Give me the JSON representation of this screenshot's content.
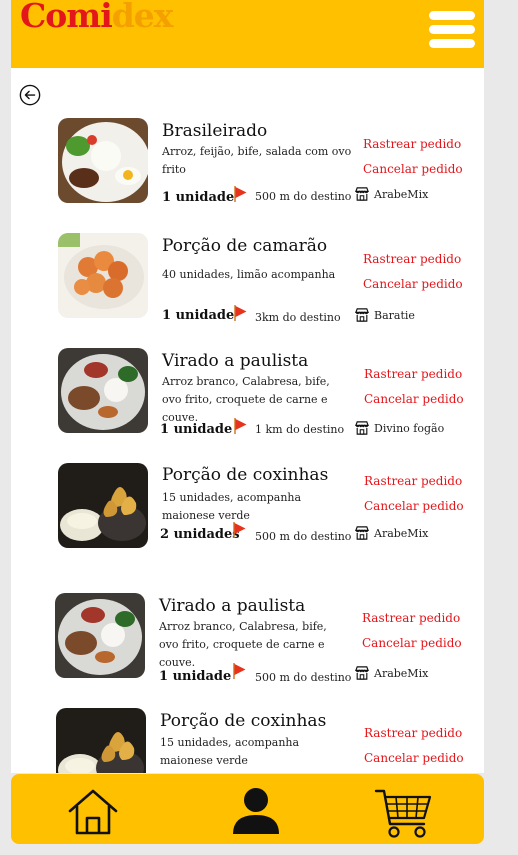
{
  "app": {
    "logo_part1": "Comi",
    "logo_part2": "dex"
  },
  "actions": {
    "track": "Rastrear pedido",
    "cancel": "Cancelar pedido"
  },
  "orders": [
    {
      "name": "Brasileirado",
      "desc": "Arroz, feijão, bife, salada com ovo frito",
      "qty": "1 unidade",
      "dist": "500 m do destino",
      "store": "ArabeMix"
    },
    {
      "name": "Porção de camarão",
      "desc": "40 unidades, limão acompanha",
      "qty": "1 unidade",
      "dist": "3km do destino",
      "store": "Baratie"
    },
    {
      "name": "Virado a paulista",
      "desc": "Arroz branco, Calabresa, bife, ovo frito, croquete de carne e couve.",
      "qty": "1 unidade",
      "dist": "1 km do destino",
      "store": "Divino fogão"
    },
    {
      "name": "Porção de coxinhas",
      "desc": "15 unidades, acompanha maionese verde",
      "qty": "2 unidades",
      "dist": "500 m do destino",
      "store": "ArabeMix"
    },
    {
      "name": "Virado a paulista",
      "desc": "Arroz branco, Calabresa, bife, ovo frito, croquete de carne e couve.",
      "qty": "1 unidade",
      "dist": "500 m do destino",
      "store": "ArabeMix"
    },
    {
      "name": "Porção de coxinhas",
      "desc": "15 unidades, acompanha maionese verde",
      "qty": "",
      "dist": "",
      "store": ""
    }
  ],
  "icons": {
    "menu": "hamburger-icon",
    "back": "arrow-left-circle-icon",
    "flag": "flag-icon",
    "store": "store-icon",
    "home": "home-icon",
    "profile": "user-icon",
    "cart": "cart-icon"
  },
  "colors": {
    "brand_yellow": "#ffc000",
    "logo_red": "#e3161b",
    "logo_orange": "#f4a000",
    "action_red": "#e3161b",
    "flag_red": "#e8331c"
  }
}
